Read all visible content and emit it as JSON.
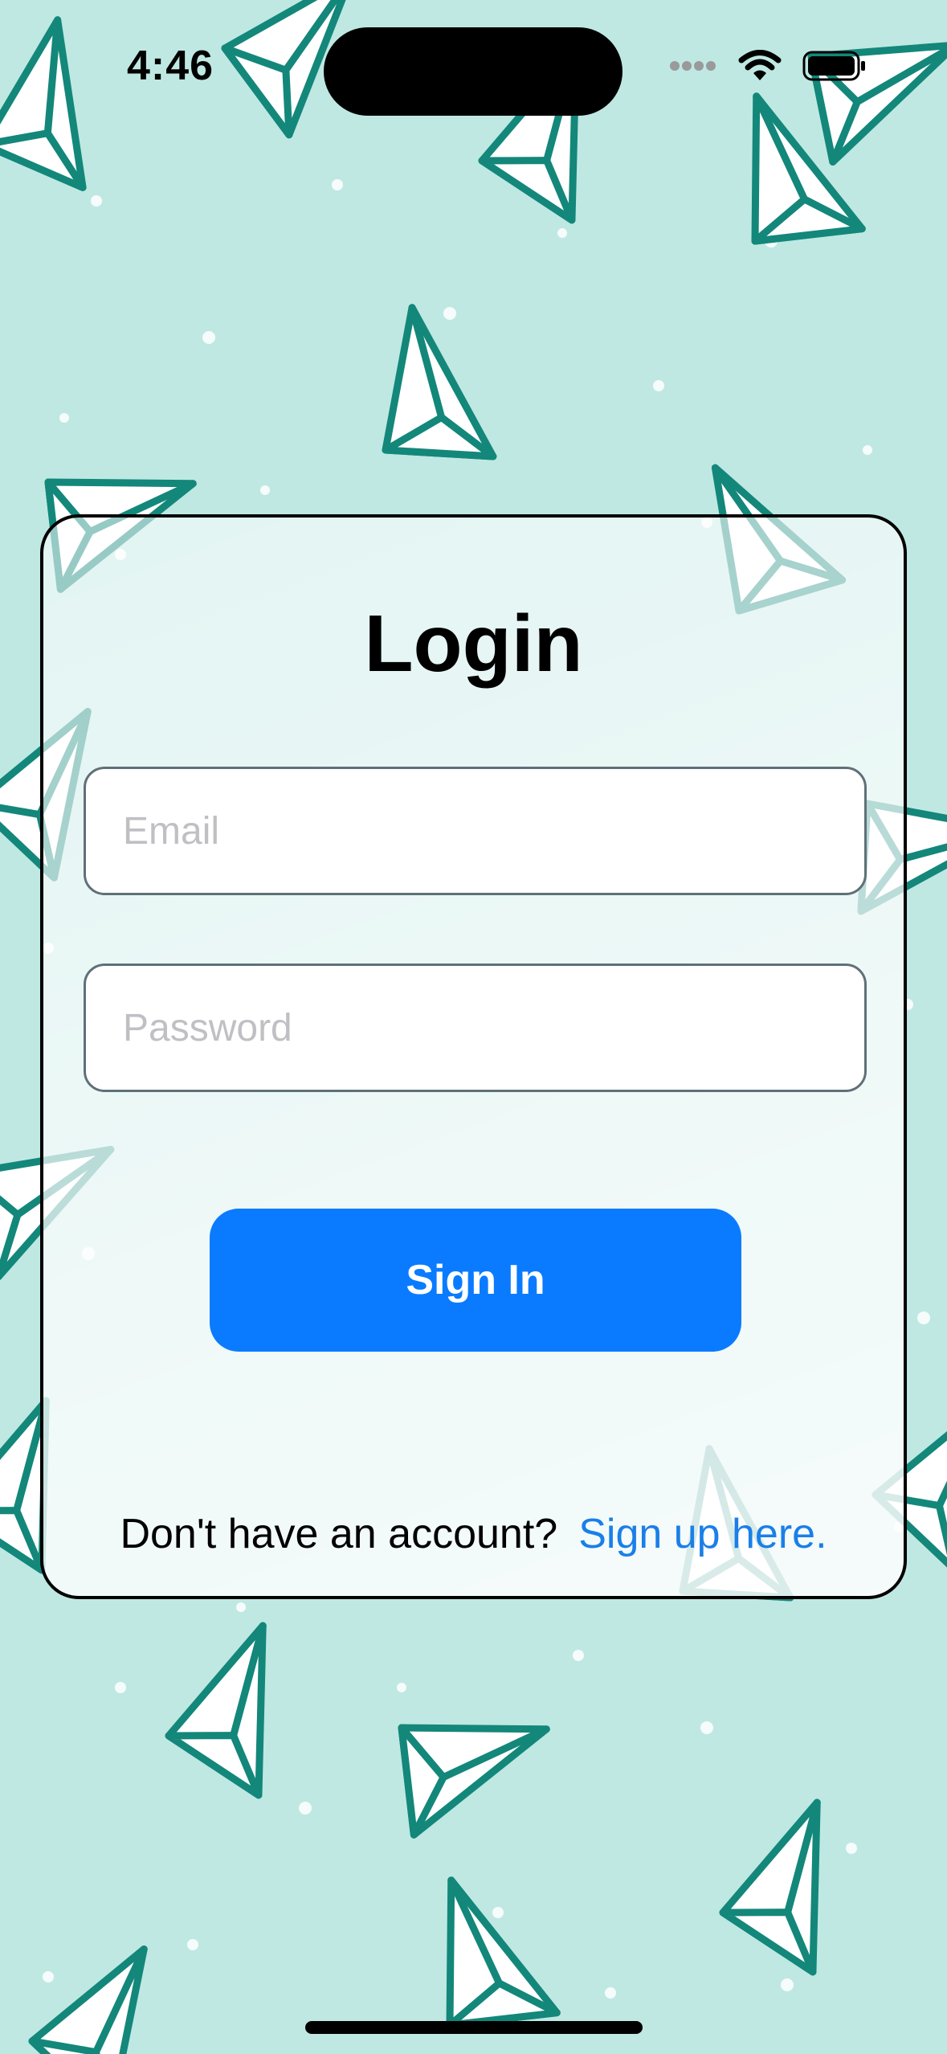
{
  "status_bar": {
    "time": "4:46",
    "icons": [
      "signal-dots-icon",
      "wifi-icon",
      "battery-icon"
    ]
  },
  "background": {
    "color": "#bfe8e3",
    "pattern": "paper-plane-pattern",
    "plane_color": "#13877a"
  },
  "login": {
    "title": "Login",
    "email_placeholder": "Email",
    "email_value": "",
    "password_placeholder": "Password",
    "password_value": "",
    "signin_label": "Sign In",
    "signup_prompt": "Don't have an account?",
    "signup_link": "Sign up here."
  },
  "colors": {
    "accent": "#0a7bff",
    "link": "#1a7fe8"
  }
}
